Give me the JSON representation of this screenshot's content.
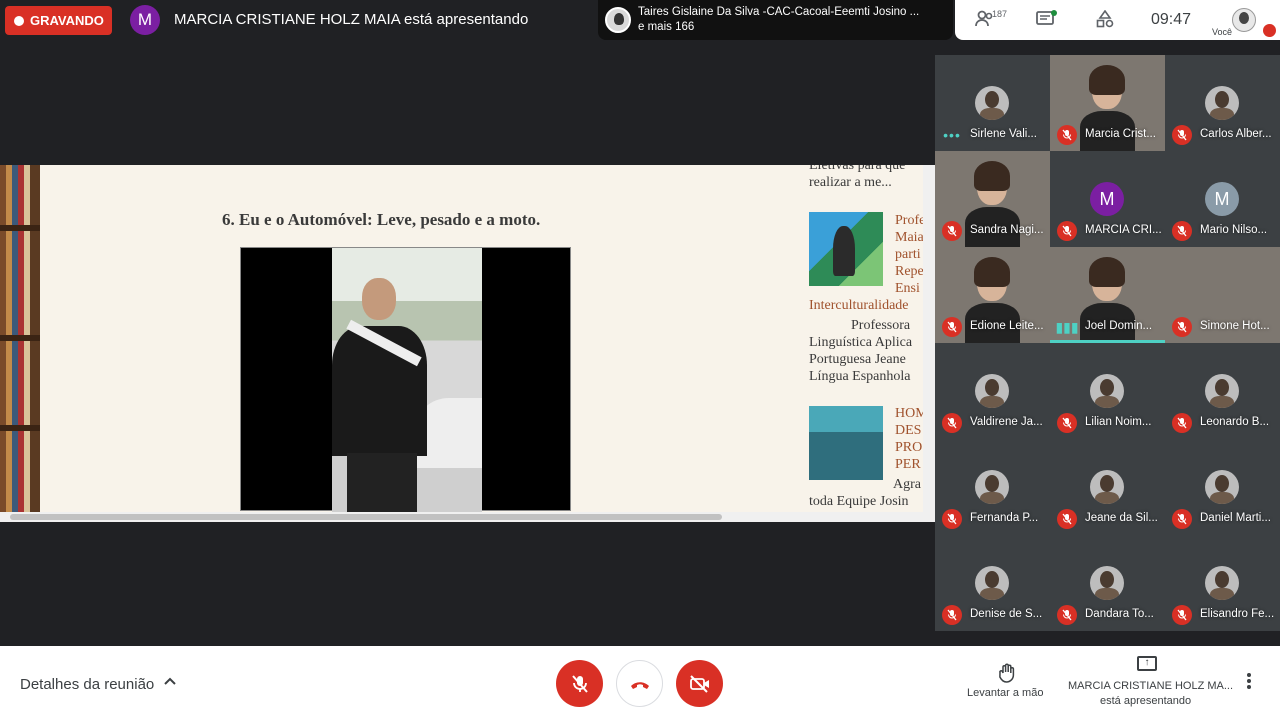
{
  "topbar": {
    "recording_label": "GRAVANDO",
    "presenter_initial": "M",
    "presenter_text": "MARCIA CRISTIANE HOLZ MAIA está apresentando",
    "speaker_name": "Taires Gislaine Da Silva -CAC-Cacoal-Eeemti Josino ...",
    "speaker_more": "e mais 166",
    "people_count": "187",
    "time": "09:47",
    "you_label": "Você"
  },
  "presentation": {
    "slide_title": "6. Eu e o Automóvel: Leve, pesado e a moto.",
    "blog": {
      "snippet_top_1": "Eletivas para que ",
      "snippet_top_2": "realizar a me...",
      "post1_title": [
        "Profe",
        "Maia",
        "parti",
        "Repe",
        "Ensi"
      ],
      "post1_line": "Interculturalidade",
      "post1_body": [
        "Professora",
        "Linguística Aplica",
        "Portuguesa Jeane",
        "Língua Espanhola"
      ],
      "post2_title": [
        "HOM",
        "DES",
        "PRO",
        "PER"
      ],
      "post2_body": [
        "Agra",
        "toda Equipe Josin"
      ]
    }
  },
  "participants": [
    {
      "name": "Sirlene Vali...",
      "avatar": "photo",
      "mic": "dots",
      "tile": "plain"
    },
    {
      "name": "Marcia Crist...",
      "avatar": "video",
      "mic": "muted",
      "tile": "video"
    },
    {
      "name": "Carlos Alber...",
      "avatar": "photo",
      "mic": "muted",
      "tile": "plain"
    },
    {
      "name": "Sandra Nagi...",
      "avatar": "video",
      "mic": "muted",
      "tile": "video"
    },
    {
      "name": "MARCIA CRI...",
      "avatar": "M",
      "mic": "muted",
      "tile": "plain"
    },
    {
      "name": "Mario Nilso...",
      "avatar": "M",
      "mic": "muted",
      "tile": "plain"
    },
    {
      "name": "Edione Leite...",
      "avatar": "video",
      "mic": "muted",
      "tile": "video"
    },
    {
      "name": "Joel Domin...",
      "avatar": "video",
      "mic": "speaking",
      "tile": "video"
    },
    {
      "name": "Simone Hot...",
      "avatar": "none",
      "mic": "muted",
      "tile": "video"
    },
    {
      "name": "Valdirene Ja...",
      "avatar": "photo",
      "mic": "muted",
      "tile": "plain"
    },
    {
      "name": "Lilian Noim...",
      "avatar": "photo",
      "mic": "muted",
      "tile": "plain"
    },
    {
      "name": "Leonardo B...",
      "avatar": "photo",
      "mic": "muted",
      "tile": "plain"
    },
    {
      "name": "Fernanda P...",
      "avatar": "photo",
      "mic": "muted",
      "tile": "plain"
    },
    {
      "name": "Jeane da Sil...",
      "avatar": "photo",
      "mic": "muted",
      "tile": "plain"
    },
    {
      "name": "Daniel Marti...",
      "avatar": "photo",
      "mic": "muted",
      "tile": "plain"
    },
    {
      "name": "Denise de S...",
      "avatar": "photo",
      "mic": "muted",
      "tile": "plain"
    },
    {
      "name": "Dandara To...",
      "avatar": "photo",
      "mic": "muted",
      "tile": "plain"
    },
    {
      "name": "Elisandro Fe...",
      "avatar": "photo",
      "mic": "muted",
      "tile": "plain"
    }
  ],
  "avatar_colors": {
    "M_purple": "#7b1fa2",
    "M_gray": "#8a9ba8"
  },
  "bottombar": {
    "details_label": "Detalhes da reunião",
    "raise_hand_label": "Levantar a mão",
    "presenting_name": "MARCIA CRISTIANE HOLZ MA...",
    "presenting_sub": "está apresentando"
  },
  "colors": {
    "recording": "#d93025",
    "accent": "#4ed1c4",
    "background": "#202124"
  }
}
